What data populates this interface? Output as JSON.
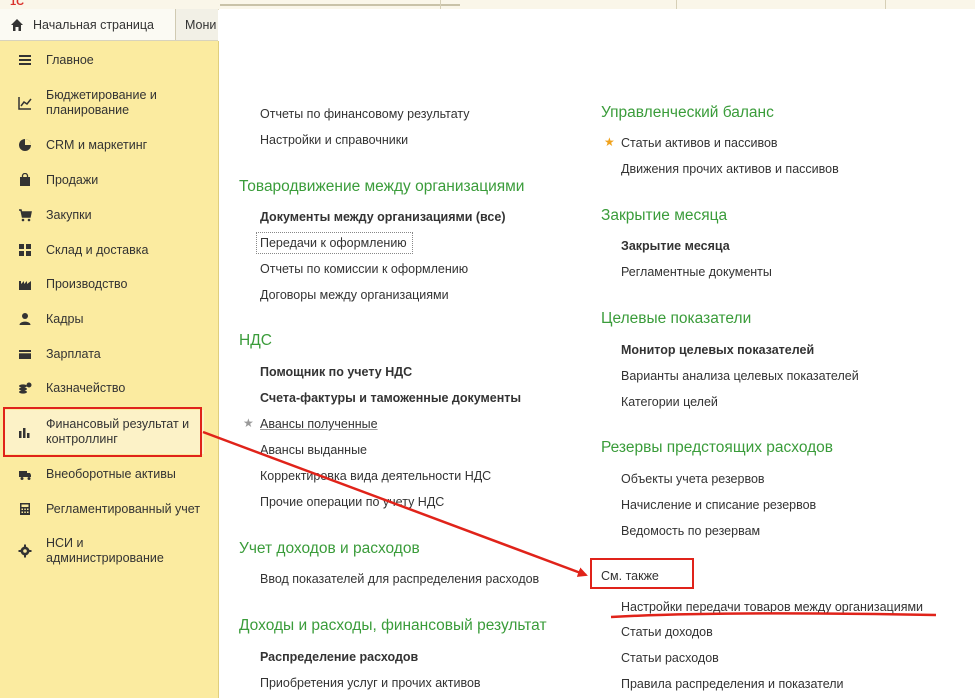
{
  "tabs": [
    {
      "label": "Начальная страница",
      "icon": "home-icon"
    },
    {
      "label": "Мони"
    }
  ],
  "sidebar": {
    "items": [
      {
        "label": "Главное",
        "icon": "menu-lines-icon"
      },
      {
        "label": "Бюджетирование и планирование",
        "icon": "chart-line-icon"
      },
      {
        "label": "CRM и маркетинг",
        "icon": "pie-chart-icon"
      },
      {
        "label": "Продажи",
        "icon": "shopping-bag-icon"
      },
      {
        "label": "Закупки",
        "icon": "cart-icon"
      },
      {
        "label": "Склад и доставка",
        "icon": "warehouse-grid-icon"
      },
      {
        "label": "Производство",
        "icon": "factory-icon"
      },
      {
        "label": "Кадры",
        "icon": "person-icon"
      },
      {
        "label": "Зарплата",
        "icon": "wallet-icon"
      },
      {
        "label": "Казначейство",
        "icon": "coins-icon"
      },
      {
        "label": "Финансовый результат и контроллинг",
        "icon": "bar-chart-icon"
      },
      {
        "label": "Внеоборотные активы",
        "icon": "truck-icon"
      },
      {
        "label": "Регламентированный учет",
        "icon": "calculator-icon"
      },
      {
        "label": "НСИ и администрирование",
        "icon": "gear-icon"
      }
    ]
  },
  "left_column": {
    "top_links": [
      "Отчеты по финансовому результату",
      "Настройки и справочники"
    ],
    "sections": [
      {
        "title": "Товародвижение между организациями",
        "links": [
          "Документы между организациями (все)",
          "Передачи к оформлению",
          "Отчеты по комиссии к оформлению",
          "Договоры между организациями"
        ]
      },
      {
        "title": "НДС",
        "links": [
          "Помощник по учету НДС",
          "Счета-фактуры и таможенные документы",
          "Авансы полученные",
          "Авансы выданные",
          "Корректировка вида деятельности НДС",
          "Прочие операции по учету НДС"
        ]
      },
      {
        "title": "Учет доходов и расходов",
        "links": [
          "Ввод показателей для распределения расходов"
        ]
      },
      {
        "title": "Доходы и расходы, финансовый результат",
        "links": [
          "Распределение расходов",
          "Приобретения услуг и прочих активов"
        ]
      }
    ]
  },
  "right_column": {
    "sections": [
      {
        "title": "Управленческий баланс",
        "links": [
          "Статьи активов и пассивов",
          "Движения прочих активов и пассивов"
        ]
      },
      {
        "title": "Закрытие месяца",
        "links": [
          "Закрытие месяца",
          "Регламентные документы"
        ]
      },
      {
        "title": "Целевые показатели",
        "links": [
          "Монитор целевых показателей",
          "Варианты анализа целевых показателей",
          "Категории целей"
        ]
      },
      {
        "title": "Резервы предстоящих расходов",
        "links": [
          "Объекты учета резервов",
          "Начисление и списание резервов",
          "Ведомость по резервам"
        ]
      }
    ],
    "see_also": {
      "title": "См. также",
      "links": [
        "Настройки передачи товаров между организациями",
        "Статьи доходов",
        "Статьи расходов",
        "Правила распределения и показатели"
      ]
    }
  },
  "colors": {
    "sidebar_bg": "#fbeba0",
    "section_title": "#3a9c3a",
    "annotation_red": "#e0231a",
    "favorite_star": "#f0a21c"
  }
}
